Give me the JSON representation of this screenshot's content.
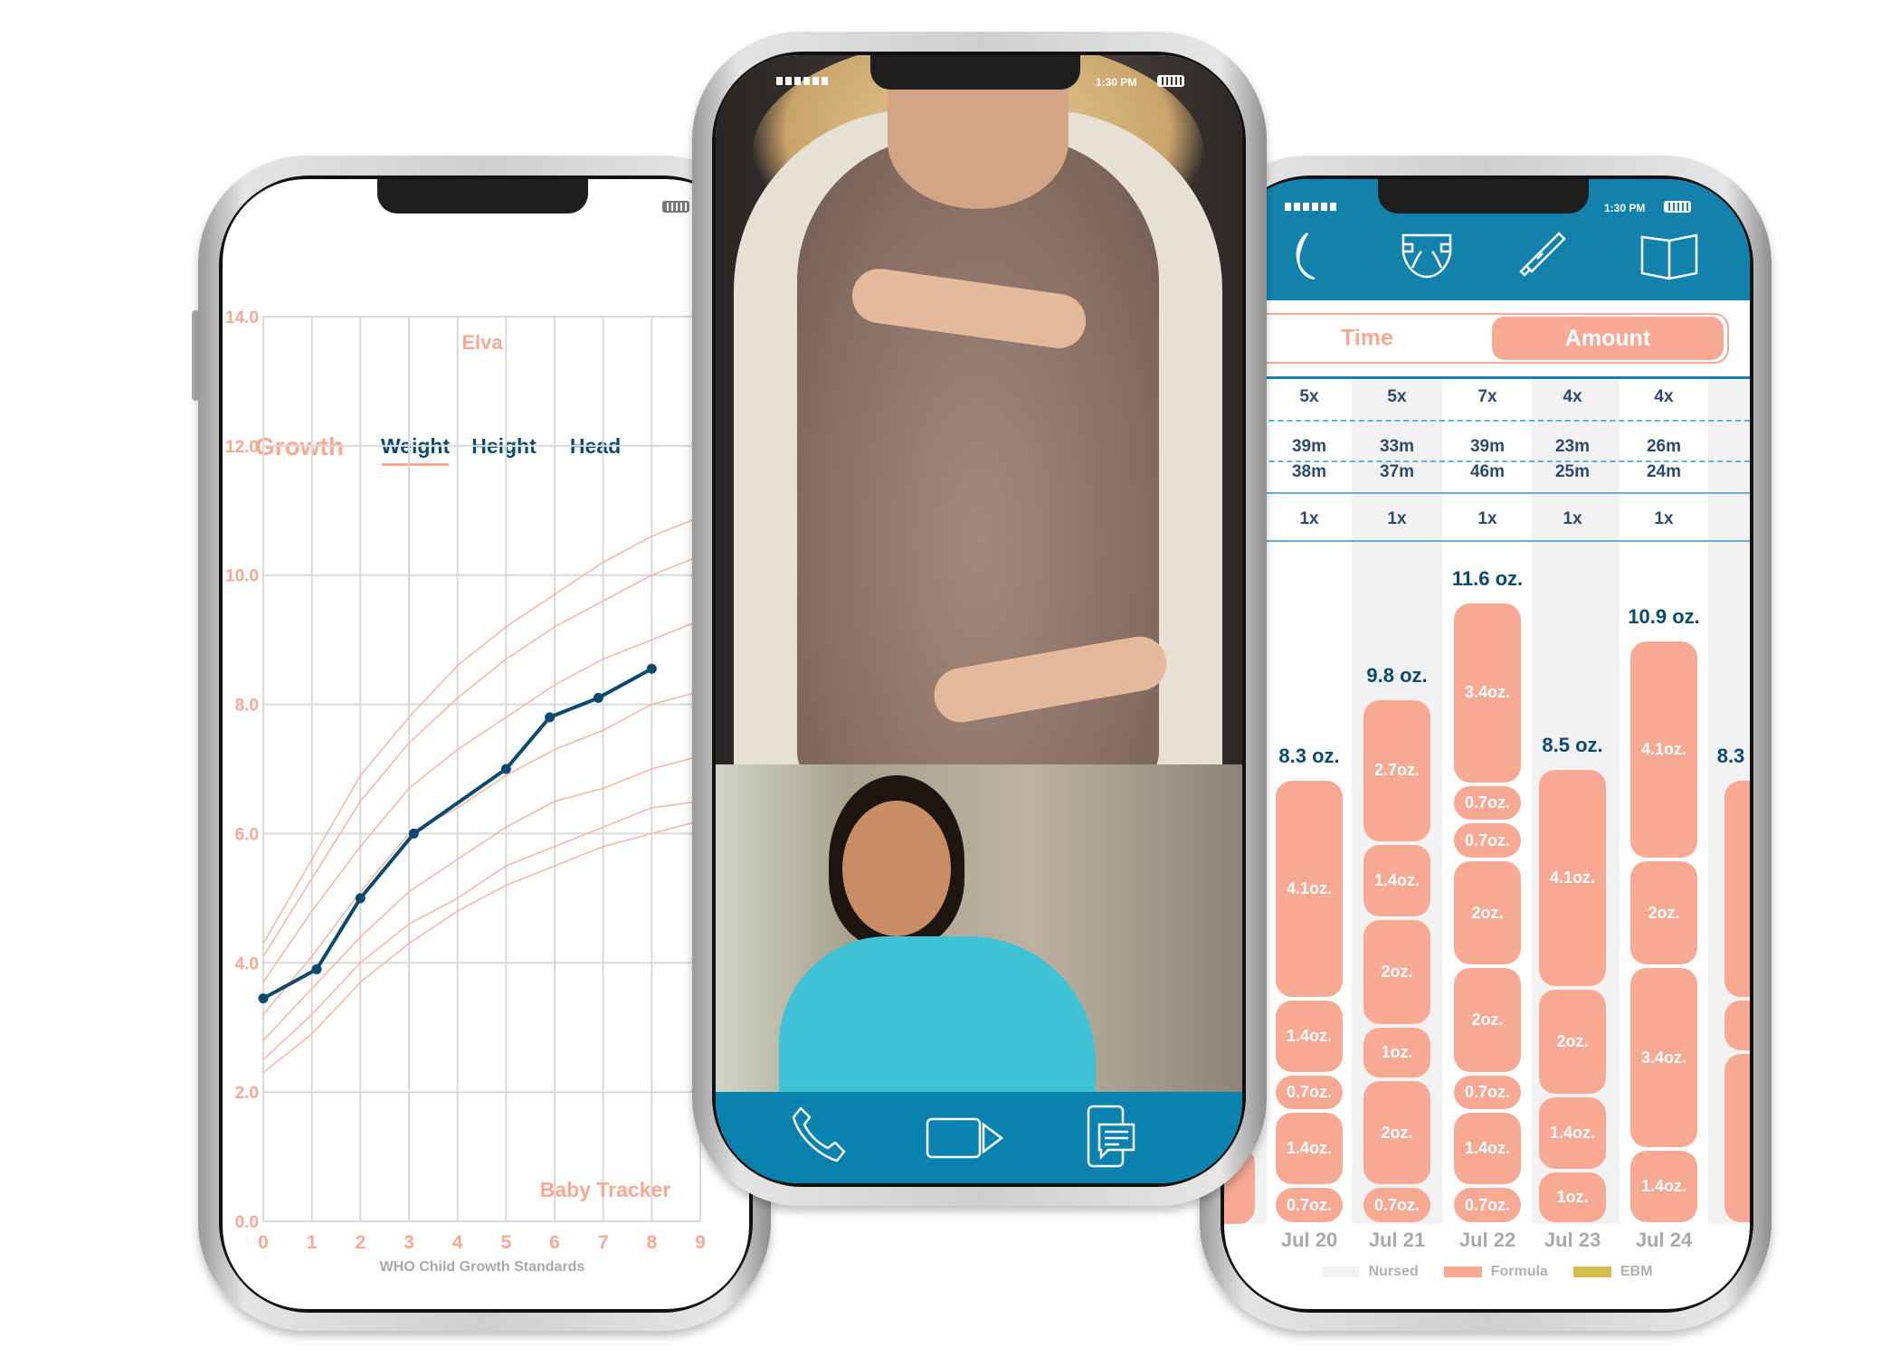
{
  "colors": {
    "accent": "#f7a994",
    "navy": "#0b4a6e",
    "header_blue": "#1282ad",
    "call_bar_blue": "#0a82b0",
    "nursed": "#f2f2f2",
    "formula": "#f7a994",
    "ebm": "#d4bf4e"
  },
  "growth_phone": {
    "title": "Growth",
    "tabs": [
      {
        "label": "Weight",
        "active": true
      },
      {
        "label": "Height",
        "active": false
      },
      {
        "label": "Head",
        "active": false
      }
    ],
    "child_name": "Elva",
    "watermark": "Baby Tracker",
    "footer": "WHO Child Growth Standards"
  },
  "chart_data": [
    {
      "type": "line",
      "title": "",
      "x_ticks": [
        "0",
        "1",
        "2",
        "3",
        "4",
        "5",
        "6",
        "7",
        "8",
        "9"
      ],
      "y_ticks": [
        "0.0",
        "2.0",
        "4.0",
        "6.0",
        "8.0",
        "10.0",
        "12.0",
        "14.0"
      ],
      "xlim": [
        0,
        9
      ],
      "ylim": [
        0,
        14
      ],
      "grid": true,
      "series": [
        {
          "values": [
            [
              0,
              3.45
            ],
            [
              1.1,
              3.9
            ],
            [
              2,
              5.0
            ],
            [
              3.1,
              6.0
            ],
            [
              5,
              7.0
            ],
            [
              5.9,
              7.8
            ],
            [
              6.9,
              8.1
            ],
            [
              8,
              8.55
            ]
          ]
        }
      ],
      "reference_curves": {
        "x": [
          0,
          1,
          2,
          3,
          4,
          5,
          6,
          7,
          8,
          9
        ],
        "curves": [
          [
            4.3,
            5.6,
            6.9,
            7.8,
            8.6,
            9.2,
            9.7,
            10.2,
            10.6,
            10.9
          ],
          [
            4.1,
            5.3,
            6.5,
            7.4,
            8.1,
            8.7,
            9.2,
            9.6,
            10.0,
            10.3
          ],
          [
            3.7,
            4.8,
            5.8,
            6.7,
            7.3,
            7.8,
            8.3,
            8.7,
            9.0,
            9.3
          ],
          [
            3.2,
            4.1,
            5.1,
            6.0,
            6.4,
            6.9,
            7.3,
            7.6,
            8.0,
            8.2
          ],
          [
            2.8,
            3.6,
            4.4,
            5.1,
            5.6,
            6.1,
            6.5,
            6.7,
            7.0,
            7.2
          ],
          [
            2.5,
            3.2,
            4.0,
            4.6,
            5.0,
            5.5,
            5.8,
            6.1,
            6.4,
            6.5
          ],
          [
            2.3,
            2.9,
            3.7,
            4.3,
            4.8,
            5.2,
            5.5,
            5.8,
            6.0,
            6.2
          ]
        ]
      }
    },
    {
      "type": "bar",
      "stacked": true,
      "categories": [
        "Jul 20",
        "Jul 21",
        "Jul 22",
        "Jul 23",
        "Jul 24",
        ""
      ],
      "totals": [
        "8.3 oz.",
        "9.8 oz.",
        "11.6 oz.",
        "8.5 oz.",
        "10.9 oz.",
        "8.3"
      ],
      "segments": [
        [
          4.1,
          1.4,
          0.7,
          1.4,
          0.7
        ],
        [
          2.7,
          1.4,
          2,
          1,
          2,
          0.7
        ],
        [
          3.4,
          0.7,
          0.7,
          2,
          2,
          0.7,
          1.4,
          0.7
        ],
        [
          4.1,
          2,
          1.4,
          1
        ],
        [
          4.1,
          2,
          3.4,
          1.4
        ],
        [
          4.1,
          1,
          3.2
        ]
      ],
      "segment_labels": [
        [
          "4.1oz.",
          "1.4oz.",
          "0.7oz.",
          "1.4oz.",
          "0.7oz."
        ],
        [
          "2.7oz.",
          "1.4oz.",
          "2oz.",
          "1oz.",
          "2oz.",
          "0.7oz."
        ],
        [
          "3.4oz.",
          "0.7oz.",
          "0.7oz.",
          "2oz.",
          "2oz.",
          "0.7oz.",
          "1.4oz.",
          "0.7oz."
        ],
        [
          "4.1oz.",
          "2oz.",
          "1.4oz.",
          "1oz."
        ],
        [
          "4.1oz.",
          "2oz.",
          "3.4oz.",
          "1.4oz."
        ],
        [
          "",
          "",
          ""
        ]
      ],
      "legend": [
        {
          "label": "Nursed",
          "color": "#f2f2f2"
        },
        {
          "label": "Formula",
          "color": "#f7a994"
        },
        {
          "label": "EBM",
          "color": "#d4bf4e"
        }
      ]
    }
  ],
  "video_phone": {
    "time": "1:30 PM",
    "icons": [
      "phone-icon",
      "video-camera-icon",
      "chat-message-icon"
    ]
  },
  "feeding_phone": {
    "time": "1:30 PM",
    "nav_icons": [
      "moon-icon",
      "diaper-icon",
      "thermometer-icon",
      "book-icon"
    ],
    "toggle": {
      "left": "Time",
      "right": "Amount",
      "active": "Amount"
    },
    "summary": {
      "counts": [
        "5x",
        "5x",
        "7x",
        "4x",
        "4x"
      ],
      "durations_top": [
        "39m",
        "33m",
        "39m",
        "23m",
        "26m"
      ],
      "durations_bottom": [
        "38m",
        "37m",
        "46m",
        "25m",
        "24m"
      ],
      "other": [
        "1x",
        "1x",
        "1x",
        "1x",
        "1x"
      ]
    }
  }
}
